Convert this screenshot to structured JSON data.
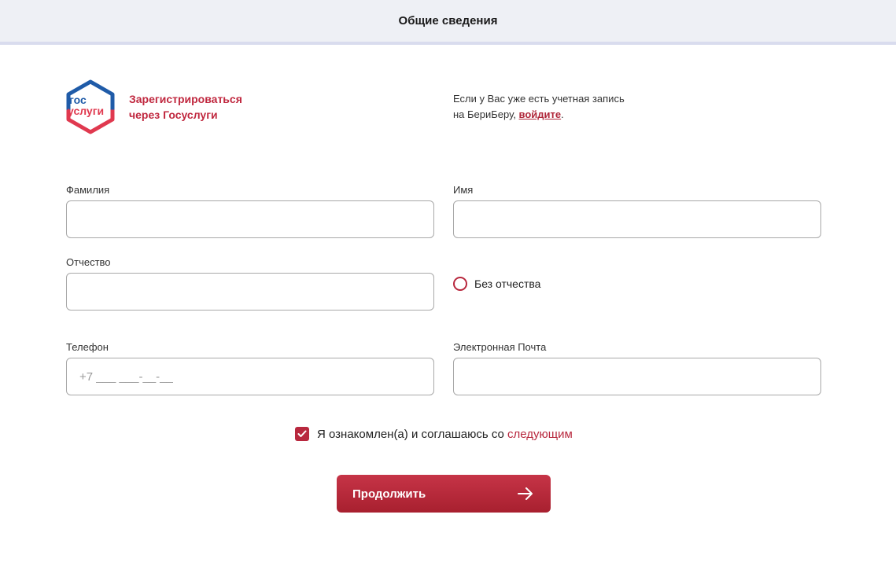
{
  "header": {
    "title": "Общие сведения"
  },
  "gosuslugi": {
    "logo_line1": "гос",
    "logo_line2": "услуги",
    "link_line1": "Зарегистрироваться",
    "link_line2": "через Госуслуги"
  },
  "login_hint": {
    "text_part1": "Если у Вас уже есть учетная запись на БериБеру, ",
    "link": "войдите",
    "text_part2": "."
  },
  "form": {
    "last_name": {
      "label": "Фамилия",
      "value": ""
    },
    "first_name": {
      "label": "Имя",
      "value": ""
    },
    "middle_name": {
      "label": "Отчество",
      "value": ""
    },
    "no_middle_name": {
      "label": "Без отчества",
      "checked": false
    },
    "phone": {
      "label": "Телефон",
      "placeholder": "+7 ___ ___-__-__",
      "value": ""
    },
    "email": {
      "label": "Электронная Почта",
      "value": ""
    }
  },
  "agreement": {
    "text": "Я ознакомлен(а) и соглашаюсь со ",
    "link": "следующим",
    "checked": true
  },
  "continue_button": {
    "label": "Продолжить"
  },
  "colors": {
    "accent": "#b8283e",
    "header_bg": "#eef0f5",
    "gos_blue": "#1f5ba8",
    "gos_red": "#e0394f"
  }
}
